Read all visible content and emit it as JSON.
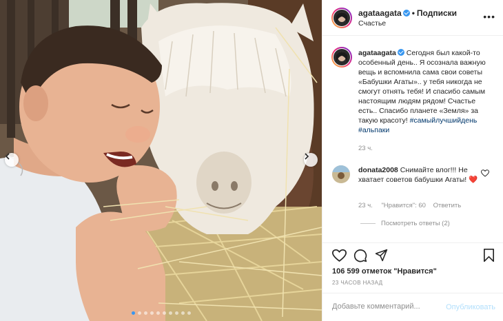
{
  "post": {
    "username": "agataagata",
    "follow_label": "Подписки",
    "separator": "•",
    "location": "Счастье",
    "more_label": "•••"
  },
  "caption": {
    "username": "agataagata",
    "text": "Сегодня был какой-то особенный день.. Я осознала важную вещь и вспомнила сама свои советы «Бабушки Агаты».. у тебя никогда не смогут отнять тебя! И спасибо самым настоящим людям рядом! Счастье есть.. Спасибо планете «Земля» за такую красоту!",
    "hashtags": [
      "#самыйлучшийдень",
      "#альпаки"
    ],
    "time": "23 ч."
  },
  "comment": {
    "username": "donata2008",
    "text": "Снимайте влог!!! Не хватает советов бабушки Агаты!",
    "emoji": "❤️",
    "time": "23 ч.",
    "likes_label": "\"Нравится\": 60",
    "reply_label": "Ответить",
    "view_replies_label": "Посмотреть ответы (2)"
  },
  "stats": {
    "likes_text": "106 599 отметок \"Нравится\"",
    "posted_ago": "23 ЧАСОВ НАЗАД"
  },
  "add_comment": {
    "placeholder": "Добавьте комментарий...",
    "publish_label": "Опубликовать"
  },
  "carousel": {
    "slide_count": 10,
    "active_index": 0
  },
  "icons": {
    "like": "heart-icon",
    "comment": "comment-icon",
    "share": "send-icon",
    "save": "bookmark-icon",
    "verified": "verified-badge-icon",
    "prev": "chevron-left-icon",
    "next": "chevron-right-icon"
  },
  "colors": {
    "link": "#00376b",
    "verified": "#3897f0",
    "muted": "#8e8e8e",
    "publish_disabled": "#b2dffc",
    "heart": "#ed4956"
  }
}
